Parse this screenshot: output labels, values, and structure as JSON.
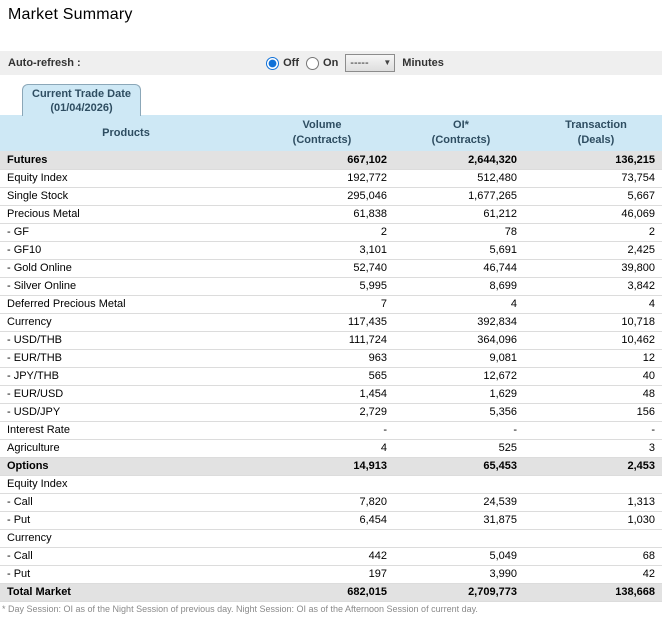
{
  "page": {
    "title": "Market Summary"
  },
  "auto_refresh": {
    "label": "Auto-refresh :",
    "options": [
      {
        "label": "Off",
        "selected": true
      },
      {
        "label": "On",
        "selected": false
      }
    ],
    "minutes_value": "-----",
    "minutes_label": "Minutes",
    "dropdown_arrow_icon": "▼"
  },
  "tab": {
    "line1": "Current Trade Date",
    "line2": "(01/04/2026)"
  },
  "table": {
    "columns": [
      {
        "label": "Products",
        "sub": ""
      },
      {
        "label": "Volume",
        "sub": "(Contracts)"
      },
      {
        "label": "OI*",
        "sub": "(Contracts)"
      },
      {
        "label": "Transaction",
        "sub": "(Deals)"
      }
    ],
    "rows": [
      {
        "type": "section",
        "label": "Futures",
        "volume": "667,102",
        "oi": "2,644,320",
        "deals": "136,215"
      },
      {
        "type": "data",
        "label": "Equity Index",
        "volume": "192,772",
        "oi": "512,480",
        "deals": "73,754"
      },
      {
        "type": "data",
        "label": "Single Stock",
        "volume": "295,046",
        "oi": "1,677,265",
        "deals": "5,667"
      },
      {
        "type": "data",
        "label": "Precious Metal",
        "volume": "61,838",
        "oi": "61,212",
        "deals": "46,069"
      },
      {
        "type": "data",
        "label": "- GF",
        "volume": "2",
        "oi": "78",
        "deals": "2"
      },
      {
        "type": "data",
        "label": "- GF10",
        "volume": "3,101",
        "oi": "5,691",
        "deals": "2,425"
      },
      {
        "type": "data",
        "label": "- Gold Online",
        "volume": "52,740",
        "oi": "46,744",
        "deals": "39,800"
      },
      {
        "type": "data",
        "label": "- Silver Online",
        "volume": "5,995",
        "oi": "8,699",
        "deals": "3,842"
      },
      {
        "type": "data",
        "label": "Deferred Precious Metal",
        "volume": "7",
        "oi": "4",
        "deals": "4"
      },
      {
        "type": "data",
        "label": "Currency",
        "volume": "117,435",
        "oi": "392,834",
        "deals": "10,718"
      },
      {
        "type": "data",
        "label": "- USD/THB",
        "volume": "111,724",
        "oi": "364,096",
        "deals": "10,462"
      },
      {
        "type": "data",
        "label": "- EUR/THB",
        "volume": "963",
        "oi": "9,081",
        "deals": "12"
      },
      {
        "type": "data",
        "label": "- JPY/THB",
        "volume": "565",
        "oi": "12,672",
        "deals": "40"
      },
      {
        "type": "data",
        "label": "- EUR/USD",
        "volume": "1,454",
        "oi": "1,629",
        "deals": "48"
      },
      {
        "type": "data",
        "label": "- USD/JPY",
        "volume": "2,729",
        "oi": "5,356",
        "deals": "156"
      },
      {
        "type": "data",
        "label": "Interest Rate",
        "volume": "-",
        "oi": "-",
        "deals": "-"
      },
      {
        "type": "data",
        "label": "Agriculture",
        "volume": "4",
        "oi": "525",
        "deals": "3"
      },
      {
        "type": "section",
        "label": "Options",
        "volume": "14,913",
        "oi": "65,453",
        "deals": "2,453"
      },
      {
        "type": "group",
        "label": "Equity Index",
        "volume": "",
        "oi": "",
        "deals": ""
      },
      {
        "type": "data",
        "label": "- Call",
        "volume": "7,820",
        "oi": "24,539",
        "deals": "1,313"
      },
      {
        "type": "data",
        "label": "- Put",
        "volume": "6,454",
        "oi": "31,875",
        "deals": "1,030"
      },
      {
        "type": "group",
        "label": "Currency",
        "volume": "",
        "oi": "",
        "deals": ""
      },
      {
        "type": "data",
        "label": "- Call",
        "volume": "442",
        "oi": "5,049",
        "deals": "68"
      },
      {
        "type": "data",
        "label": "- Put",
        "volume": "197",
        "oi": "3,990",
        "deals": "42"
      },
      {
        "type": "section",
        "label": "Total Market",
        "volume": "682,015",
        "oi": "2,709,773",
        "deals": "138,668"
      }
    ]
  },
  "footnote": "* Day Session: OI as of the Night Session of previous day. Night Session: OI as of the Afternoon Session of current day.",
  "colors": {
    "header_blue": "#cee8f5",
    "header_text": "#2e4d61",
    "section_row_gray": "#e2e2e2",
    "refresh_bar_gray": "#efefef",
    "row_border": "#dcdcdc",
    "radio_accent_blue": "#1071d8",
    "footnote_gray": "#8a8a8a"
  }
}
